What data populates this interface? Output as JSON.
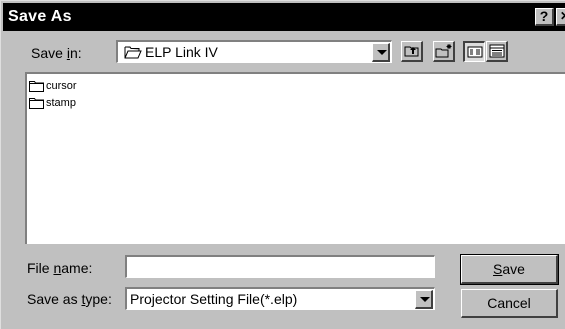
{
  "window": {
    "title": "Save As",
    "help_label": "?",
    "close_label": "✕"
  },
  "save_in": {
    "label_pre": "Save ",
    "label_key": "i",
    "label_post": "n:",
    "value": "ELP Link IV"
  },
  "toolbar": {
    "icons": [
      "up-one-level-icon",
      "create-new-folder-icon",
      "list-view-icon",
      "details-view-icon"
    ]
  },
  "files": [
    {
      "name": "cursor",
      "icon": "folder-icon"
    },
    {
      "name": "stamp",
      "icon": "folder-icon"
    }
  ],
  "file_name": {
    "label_pre": "File ",
    "label_key": "n",
    "label_post": "ame:",
    "value": ""
  },
  "save_as_type": {
    "label_pre": "Save as ",
    "label_key": "t",
    "label_post": "ype:",
    "value": "Projector Setting File(*.elp)"
  },
  "buttons": {
    "save_key": "S",
    "save_rest": "ave",
    "cancel": "Cancel"
  }
}
